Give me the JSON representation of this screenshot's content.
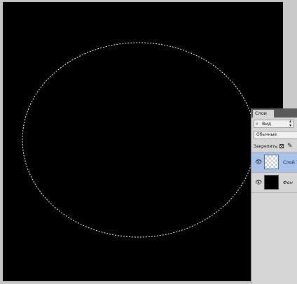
{
  "layers_panel": {
    "tab_label": "Слои",
    "filter": {
      "value": "Вид",
      "icon": "search-icon"
    },
    "blend_mode": "Обычные",
    "lock_label": "Закрепить:",
    "layers": [
      {
        "name": "Слой 1",
        "selected": true,
        "visible": true,
        "thumb": "transparent"
      },
      {
        "name": "Фон",
        "selected": false,
        "visible": true,
        "thumb": "black"
      }
    ]
  },
  "canvas": {
    "background": "#000000",
    "selection": "elliptical marquee (marching ants)"
  },
  "colors": {
    "workspace": "#c6c6c6",
    "selected_layer": "#a9c2e8"
  }
}
